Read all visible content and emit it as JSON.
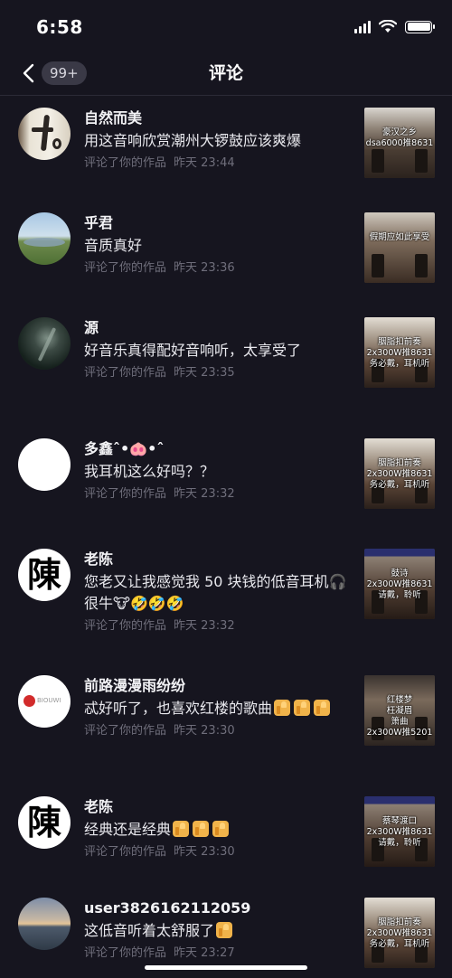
{
  "status_bar": {
    "time": "6:58"
  },
  "header": {
    "title": "评论",
    "badge": "99+"
  },
  "comments": [
    {
      "name": "自然而美",
      "text": "用这音响欣赏潮州大锣鼓应该爽爆",
      "action": "评论了你的作品",
      "time": "昨天 23:44",
      "thumb_caption": "豪汉之乡\ndsa6000推8631",
      "avatar_style": "calligraphy"
    },
    {
      "name": "乎君",
      "text": "音质真好",
      "action": "评论了你的作品",
      "time": "昨天 23:36",
      "thumb_caption": "假期应如此享受",
      "avatar_style": "landscape"
    },
    {
      "name": "源",
      "text": "好音乐真得配好音响听，太享受了",
      "action": "评论了你的作品",
      "time": "昨天 23:35",
      "thumb_caption": "胭脂扣前奏\n2x300W推8631\n务必戴，耳机听",
      "avatar_style": "dark"
    },
    {
      "name": "多鑫ˆ•🐽•ˆ",
      "text": "我耳机这么好吗？？",
      "action": "评论了你的作品",
      "time": "昨天 23:32",
      "thumb_caption": "胭脂扣前奏\n2x300W推8631\n务必戴，耳机听",
      "avatar_style": "white"
    },
    {
      "name": "老陈",
      "text": "您老又让我感觉我 50 块钱的低音耳机🎧很牛🐮🤣🤣🤣",
      "action": "评论了你的作品",
      "time": "昨天 23:32",
      "thumb_caption": "鼓诗\n2x300W推8631\n请戴，聆听",
      "avatar_style": "char"
    },
    {
      "name": "前路漫漫雨纷纷",
      "text": "忒好听了，也喜欢红楼的歌曲👍👍👍",
      "action": "评论了你的作品",
      "time": "昨天 23:30",
      "thumb_caption": "红楼梦\n枉凝眉\n箫曲\n2x300W推5201",
      "avatar_style": "logo"
    },
    {
      "name": "老陈",
      "text": "经典还是经典👍👍👍",
      "action": "评论了你的作品",
      "time": "昨天 23:30",
      "thumb_caption": "蔡琴渡口\n2x300W推8631\n请戴，聆听",
      "avatar_style": "char"
    },
    {
      "name": "user3826162112059",
      "text": "这低音听着太舒服了👍",
      "action": "评论了你的作品",
      "time": "昨天 23:27",
      "thumb_caption": "胭脂扣前奏\n2x300W推8631\n务必戴，耳机听",
      "avatar_style": "sunset"
    }
  ],
  "avatar_char": "陳",
  "avatar_logo_text": "BIOUWI",
  "colors": {
    "background": "#16151f",
    "meta": "#6f6e7b",
    "badge_bg": "#3a3946"
  },
  "icons": [
    "back-arrow-icon",
    "signal-icon",
    "wifi-icon",
    "battery-icon",
    "thumbs-up-icon"
  ]
}
